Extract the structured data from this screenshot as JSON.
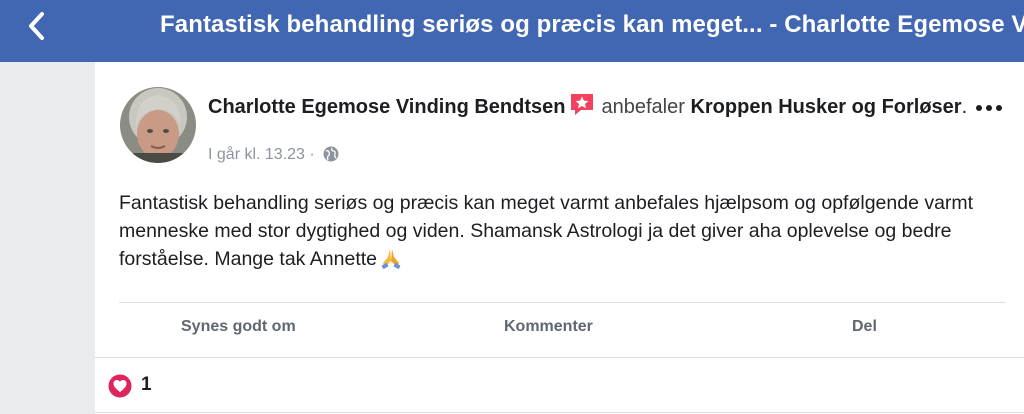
{
  "header": {
    "title": "Fantastisk behandling seriøs og præcis kan meget... - Charlotte Egemose Vinding Bendtsen"
  },
  "post": {
    "author": "Charlotte Egemose Vinding Bendtsen",
    "verb": "anbefaler",
    "page_name": "Kroppen Husker og Forløser",
    "trailing_period": ".",
    "timestamp": "I går kl. 13.23",
    "separator": "·",
    "body": "Fantastisk behandling seriøs og præcis kan meget varmt anbefales hjælpsom og opfølgende varmt menneske med stor dygtighed og viden. Shamansk Astrologi ja det giver aha oplevelse og bedre forståelse. Mange tak Annette",
    "icons": {
      "recommend": "recommend-star-icon",
      "privacy": "globe-icon",
      "emoji": "praying-hands-icon",
      "more": "more-dots-icon"
    }
  },
  "actions": {
    "like": "Synes godt om",
    "comment": "Kommenter",
    "share": "Del"
  },
  "reactions": {
    "type": "love",
    "count": "1"
  },
  "colors": {
    "brand": "#4267b2",
    "recommend": "#f3425f",
    "love": "#e0245e"
  }
}
